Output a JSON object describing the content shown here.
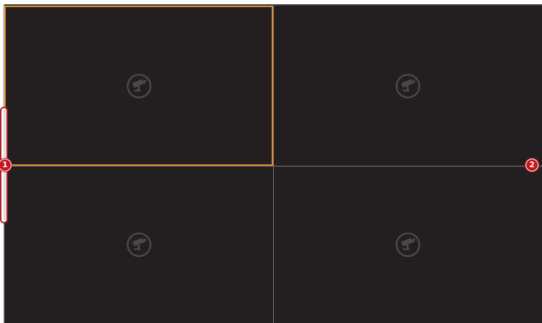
{
  "video_wall": {
    "layout": "2x2",
    "selected_tile": 1,
    "tiles": [
      {
        "id": 1,
        "state": "no-signal",
        "icon": "camera-icon"
      },
      {
        "id": 2,
        "state": "no-signal",
        "icon": "camera-icon"
      },
      {
        "id": 3,
        "state": "no-signal",
        "icon": "camera-icon"
      },
      {
        "id": 4,
        "state": "no-signal",
        "icon": "camera-icon"
      }
    ]
  },
  "callouts": {
    "left_toolbar": "1",
    "window_divider": "2"
  },
  "colors": {
    "tile_background": "#231f20",
    "selection_border": "#e08a2e",
    "divider": "#7a7a7a",
    "callout": "#c4161c"
  }
}
